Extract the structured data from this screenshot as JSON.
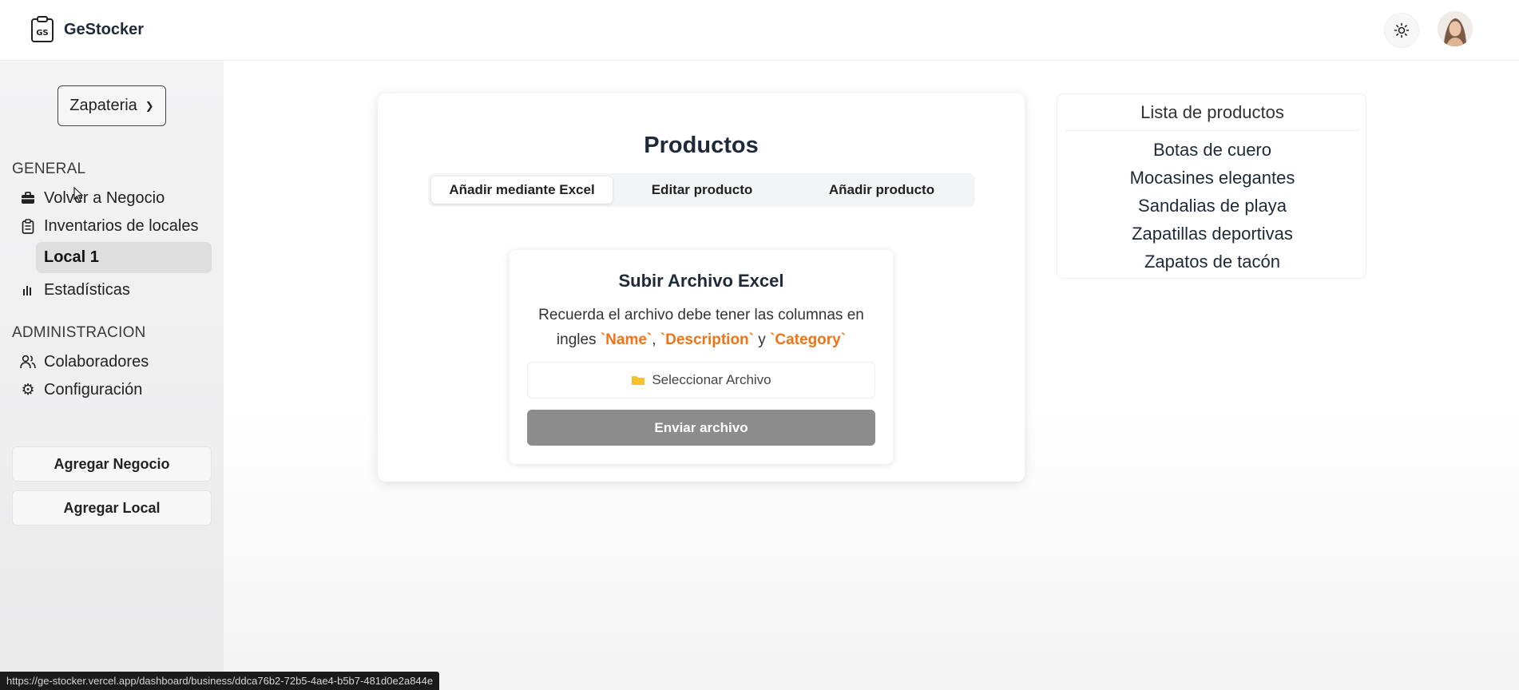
{
  "app": {
    "name": "GeStocker",
    "logo_text": "GS"
  },
  "header": {
    "theme_icon": "sun-icon",
    "avatar_icon": "user-avatar"
  },
  "sidebar": {
    "business_select": {
      "value": "Zapateria"
    },
    "general_title": "GENERAL",
    "general_items": [
      {
        "label": "Volver a Negocio",
        "icon": "briefcase-icon"
      },
      {
        "label": "Inventarios de locales",
        "icon": "clipboard-icon"
      },
      {
        "label": "Local 1"
      },
      {
        "label": "Estadísticas",
        "icon": "bar-chart-icon"
      }
    ],
    "admin_title": "ADMINISTRACION",
    "admin_items": [
      {
        "label": "Colaboradores",
        "icon": "users-icon"
      },
      {
        "label": "Configuración",
        "icon": "gear-icon"
      }
    ],
    "buttons": {
      "add_business": "Agregar Negocio",
      "add_local": "Agregar Local"
    }
  },
  "products": {
    "title": "Productos",
    "tabs": [
      {
        "label": "Añadir mediante Excel",
        "active": true
      },
      {
        "label": "Editar producto",
        "active": false
      },
      {
        "label": "Añadir producto",
        "active": false
      }
    ],
    "upload": {
      "title": "Subir Archivo Excel",
      "desc_prefix": "Recuerda el archivo debe tener las columnas en ingles",
      "col_name": "`Name`",
      "sep": ",",
      "col_description": "`Description`",
      "conj": "y",
      "col_category": "`Category`",
      "select_file_label": "Seleccionar Archivo",
      "send_label": "Enviar archivo",
      "accent_color": "#f07417"
    }
  },
  "product_list": {
    "title": "Lista de productos",
    "items": [
      "Botas de cuero",
      "Mocasines elegantes",
      "Sandalias de playa",
      "Zapatillas deportivas",
      "Zapatos de tacón"
    ]
  },
  "statusbar": {
    "url": "https://ge-stocker.vercel.app/dashboard/business/ddca76b2-72b5-4ae4-b5b7-481d0e2a844e"
  }
}
